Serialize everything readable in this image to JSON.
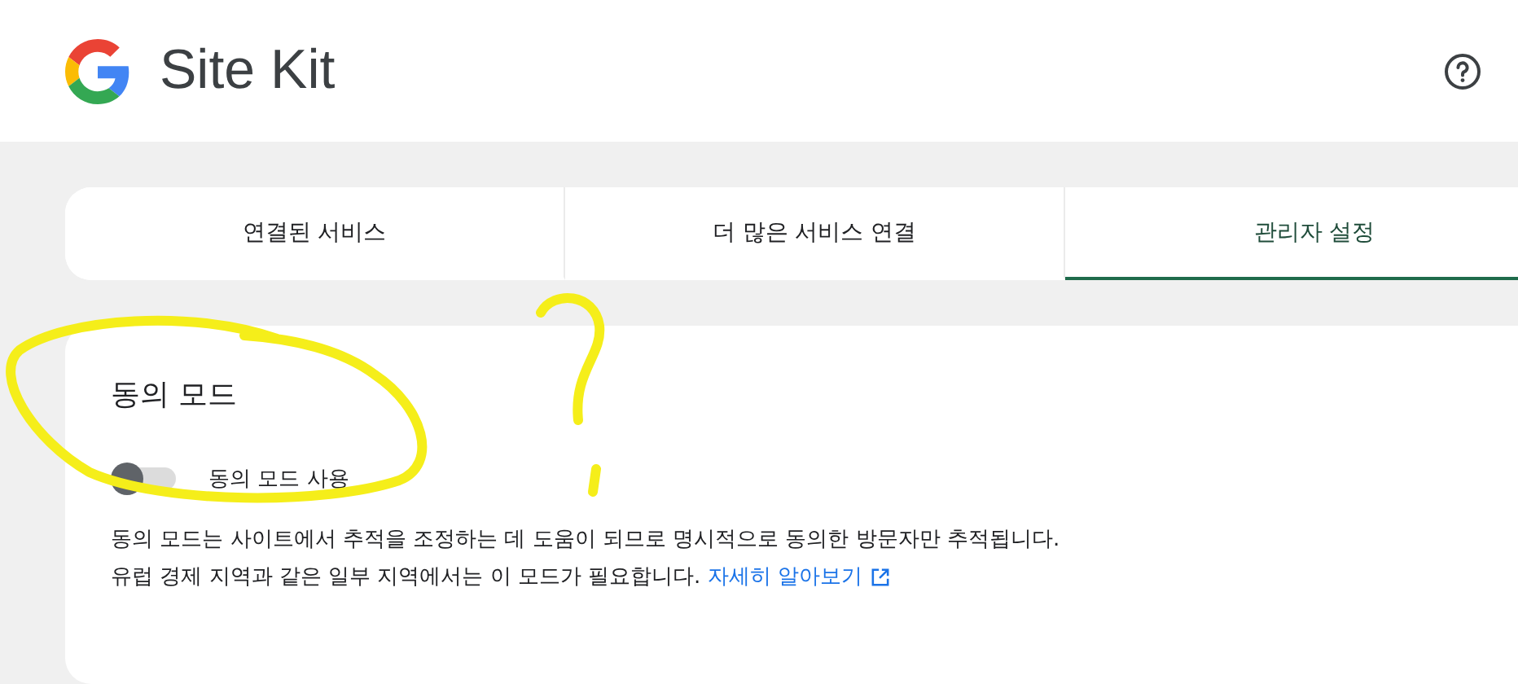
{
  "header": {
    "title": "Site Kit"
  },
  "tabs": [
    {
      "label": "연결된 서비스",
      "selected": false
    },
    {
      "label": "더 많은 서비스 연결",
      "selected": false
    },
    {
      "label": "관리자 설정",
      "selected": true
    }
  ],
  "section": {
    "title": "동의 모드",
    "toggle": {
      "label": "동의 모드 사용",
      "on": false
    },
    "description": [
      "동의 모드는 사이트에서 추적을 조정하는 데 도움이 되므로 명시적으로 동의한 방문자만 추적됩니다.",
      "유럽 경제 지역과 같은 일부 지역에서는 이 모드가 필요합니다."
    ],
    "link": "자세히 알아보기"
  }
}
